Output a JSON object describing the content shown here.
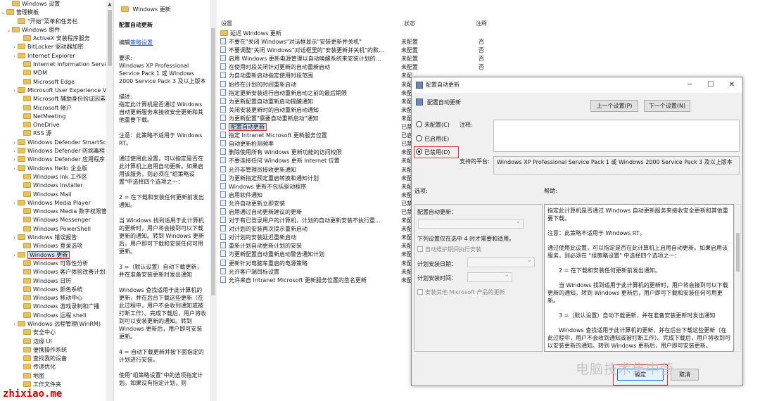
{
  "tree": {
    "items": [
      {
        "label": "Windows 设置",
        "indent": 1,
        "tw": ""
      },
      {
        "label": "管理模板",
        "indent": 0,
        "tw": "⌄"
      },
      {
        "label": "\"开始\"菜单和任务栏",
        "indent": 2,
        "tw": ""
      },
      {
        "label": "Windows 组件",
        "indent": 1,
        "tw": "⌄"
      },
      {
        "label": "ActiveX 安装程序服务",
        "indent": 3,
        "tw": ""
      },
      {
        "label": "BitLocker 驱动器加密",
        "indent": 2,
        "tw": "›"
      },
      {
        "label": "Internet Explorer",
        "indent": 2,
        "tw": "›"
      },
      {
        "label": "Internet Information Service",
        "indent": 3,
        "tw": ""
      },
      {
        "label": "MDM",
        "indent": 3,
        "tw": ""
      },
      {
        "label": "Microsoft Edge",
        "indent": 3,
        "tw": ""
      },
      {
        "label": "Microsoft User Experience V",
        "indent": 2,
        "tw": "›"
      },
      {
        "label": "Microsoft 辅助身份验证因素",
        "indent": 3,
        "tw": ""
      },
      {
        "label": "Microsoft 帐户",
        "indent": 3,
        "tw": ""
      },
      {
        "label": "NetMeeting",
        "indent": 3,
        "tw": ""
      },
      {
        "label": "OneDrive",
        "indent": 3,
        "tw": ""
      },
      {
        "label": "RSS 源",
        "indent": 3,
        "tw": ""
      },
      {
        "label": "Windows Defender SmartScr",
        "indent": 2,
        "tw": "›"
      },
      {
        "label": "Windows Defender 防病毒程",
        "indent": 2,
        "tw": "›"
      },
      {
        "label": "Windows Defender 应用程序",
        "indent": 2,
        "tw": "›"
      },
      {
        "label": "Windows Hello 企业版",
        "indent": 2,
        "tw": "›"
      },
      {
        "label": "Windows Ink 工作区",
        "indent": 3,
        "tw": ""
      },
      {
        "label": "Windows Installer",
        "indent": 3,
        "tw": ""
      },
      {
        "label": "Windows Mail",
        "indent": 3,
        "tw": ""
      },
      {
        "label": "Windows Media Player",
        "indent": 2,
        "tw": "›"
      },
      {
        "label": "Windows Media 数字权限管",
        "indent": 3,
        "tw": ""
      },
      {
        "label": "Windows Messenger",
        "indent": 3,
        "tw": ""
      },
      {
        "label": "Windows PowerShell",
        "indent": 3,
        "tw": ""
      },
      {
        "label": "Windows 错误报告",
        "indent": 2,
        "tw": "›"
      },
      {
        "label": "Windows 登录选项",
        "indent": 3,
        "tw": ""
      },
      {
        "label": "Windows 更新",
        "indent": 2,
        "tw": "›",
        "selected": true
      },
      {
        "label": "Windows 可靠性分析",
        "indent": 3,
        "tw": ""
      },
      {
        "label": "Windows 客户体验改善计划",
        "indent": 3,
        "tw": ""
      },
      {
        "label": "Windows 日历",
        "indent": 3,
        "tw": ""
      },
      {
        "label": "Windows 颜色系统",
        "indent": 3,
        "tw": ""
      },
      {
        "label": "Windows 移动中心",
        "indent": 3,
        "tw": ""
      },
      {
        "label": "Windows 游戏录制和广播",
        "indent": 3,
        "tw": ""
      },
      {
        "label": "Windows 远程 shell",
        "indent": 3,
        "tw": ""
      },
      {
        "label": "Windows 远程管理(WinRM)",
        "indent": 2,
        "tw": "›"
      },
      {
        "label": "安全中心",
        "indent": 3,
        "tw": ""
      },
      {
        "label": "边缘 UI",
        "indent": 3,
        "tw": ""
      },
      {
        "label": "便携操作系统",
        "indent": 3,
        "tw": ""
      },
      {
        "label": "查找我的设备",
        "indent": 3,
        "tw": ""
      },
      {
        "label": "传递优化",
        "indent": 3,
        "tw": ""
      },
      {
        "label": "地图",
        "indent": 3,
        "tw": ""
      },
      {
        "label": "工作文件夹",
        "indent": 3,
        "tw": ""
      }
    ]
  },
  "header": {
    "title": "Windows 更新"
  },
  "description": {
    "title": "配置自动更新",
    "edit_prefix": "编辑",
    "edit_link": "策略设置",
    "paragraphs": [
      "要求:\nWindows XP Professional Service Pack 1 或 Windows 2000 Service Pack 3 及以上版本",
      "描述:\n指定此计算机是否通过 Windows 自动更新服务来接收安全更新和其他重要下载。",
      "注意：此策略不适用于 Windows RT。",
      "通过使用此设置，可以指定是否在此计算机上启用自动更新。如果启用该服务，则必须在\"组策略设置\"中选择四个选项之一：",
      "2 = 在下载和安装任何更新前发出通知。",
      "当 Windows 找到适用于此计算机的更新时，用户将会接到可以下载更新的通知。转到 Windows 更新后，用户即可下载和安装任何可用更新。",
      "3 =（默认设置）自动下载更新，并在准备安装更新时发出通知",
      "Windows 查找适用于此计算机的更新，并在后台下载这些更新（在此过程中，用户不会收到通知或被打断工作）。完成下载后，用户将收到可以安装更新的通知。转到 Windows 更新后，用户即可安装更新。",
      "4 = 自动下载更新并按下面指定的计划进行安装。",
      "使用\"组策略设置\"中的选项指定计划。如果没有指定计划，则"
    ]
  },
  "list": {
    "col_setting": "设置",
    "col_state": "状态",
    "col_note": "注释",
    "rows": [
      {
        "name": "延迟 Windows 更新",
        "state": "",
        "note": "",
        "folder": true
      },
      {
        "name": "不要在\"关闭 Windows\"对话框显示\"安装更新并关机\"",
        "state": "未配置",
        "note": "否"
      },
      {
        "name": "不要调整\"关闭 Windows\"对话框里的\"安装更新并关机\"的默...",
        "state": "未配置",
        "note": "否"
      },
      {
        "name": "启用 Windows 更新电源管理以自动唤醒系统来安装计划的...",
        "state": "未配置",
        "note": "否"
      },
      {
        "name": "在使用时段关闭针对更新的自动重新启动",
        "state": "未配置",
        "note": "否"
      },
      {
        "name": "为自动重新启动指定使用时段范围",
        "state": "未配",
        "note": ""
      },
      {
        "name": "始终在计划的时间重新启动",
        "state": "未配",
        "note": ""
      },
      {
        "name": "指定更新安装进行自动重新启动之前的最后期限",
        "state": "未配",
        "note": ""
      },
      {
        "name": "为更新配置自动重新启动提醒通知",
        "state": "未配",
        "note": ""
      },
      {
        "name": "关闭安装更新时的自动重新启动通知",
        "state": "未配",
        "note": ""
      },
      {
        "name": "为更新配置\"需要自动重新启动\"通知",
        "state": "未配",
        "note": ""
      },
      {
        "name": "配置自动更新",
        "state": "已禁",
        "note": "",
        "highlight": true
      },
      {
        "name": "指定 Intranet Microsoft 更新服务位置",
        "state": "已启",
        "note": ""
      },
      {
        "name": "自动更新检测频率",
        "state": "已禁",
        "note": ""
      },
      {
        "name": "删除使用所有 Windows 更新功能的访问权限",
        "state": "未配",
        "note": ""
      },
      {
        "name": "不要连接任何 Windows 更新 Internet 位置",
        "state": "未配",
        "note": ""
      },
      {
        "name": "允许非管理员接收更新通知",
        "state": "未配",
        "note": ""
      },
      {
        "name": "为更新指定预定重启转换和通知计划",
        "state": "未配",
        "note": ""
      },
      {
        "name": "Windows 更新不包括驱动程序",
        "state": "未配",
        "note": ""
      },
      {
        "name": "启用软件通知",
        "state": "未配",
        "note": ""
      },
      {
        "name": "允许自动更新立即安装",
        "state": "已禁",
        "note": ""
      },
      {
        "name": "启用通过自动更新建议的更新",
        "state": "已禁",
        "note": ""
      },
      {
        "name": "对于有已登录用户的计算机，计划的自动更新安装不执行重...",
        "state": "未配",
        "note": ""
      },
      {
        "name": "对计划的安装再次提示重新启动",
        "state": "未配",
        "note": ""
      },
      {
        "name": "对计划的安装延迟重新启动",
        "state": "未配",
        "note": ""
      },
      {
        "name": "重新计划自动更新计划的安装",
        "state": "未配",
        "note": ""
      },
      {
        "name": "为更新配置自动重新启动警告通知计划",
        "state": "未配",
        "note": ""
      },
      {
        "name": "更新针对电脑车重启的电源策略",
        "state": "未配",
        "note": ""
      },
      {
        "name": "允许客户端目标设置",
        "state": "未配",
        "note": ""
      },
      {
        "name": "允许来自 Intranet Microsoft 更新服务位置的签名更新",
        "state": "未配",
        "note": ""
      }
    ]
  },
  "dialog": {
    "title": "配置自动更新",
    "subtitle": "配置自动更新",
    "prev_btn": "上一个设置(P)",
    "next_btn": "下一个设置(N)",
    "radio_unconfigured": "未配置(C)",
    "radio_enabled": "已启用(E)",
    "radio_disabled": "已禁用(D)",
    "comment_label": "注释:",
    "platform_label": "支持的平台:",
    "platform_value": "Windows XP Professional Service Pack 1 或 Windows 2000 Service Pack 3 及以上版本",
    "options_label": "选项:",
    "help_label": "帮助:",
    "opt_config": "配置自动更新：",
    "opt_note": "下列设置仅在选中 4 时才需要和适用。",
    "opt_maintenance": "自动维护期间执行安装",
    "opt_day": "计划安装日期：",
    "opt_time": "计划安装时间：",
    "opt_other": "安装其他 Microsoft 产品的更新",
    "help_paragraphs": [
      "指定此计算机是否通过 Windows 自动更新服务来接收安全更新和其他重要下载。",
      "注意：此策略不适用于 Windows RT。",
      "通过使用此设置，可以指定是否在此计算机上启用自动更新。如果启用该服务，则必须在 \"组策略设置\" 中选择四个选项之一：",
      "2 = 在下载和安装任何更新前发出通知。",
      "当 Windows 找到适用于此计算机的更新时，用户将会接到可以下载更新的通知。转到 Windows 更新后，用户即可下载和安装任何可用更新。",
      "3 =（默认设置）自动下载更新，并在准备安装更新时发出通知",
      "Windows 查找适用于此计算机的更新，并在后台下载这些更新（在此过程中，用户不会收到通知或被打断工作）。完成下载后，用户将收到可以安装更新的通知。转到 Windows 更新后，用户即可安装更新。"
    ],
    "ok_btn": "确定",
    "cancel_btn": "取消"
  },
  "watermark": "电脑技术集中营",
  "site_mark": "zhixiao.me"
}
